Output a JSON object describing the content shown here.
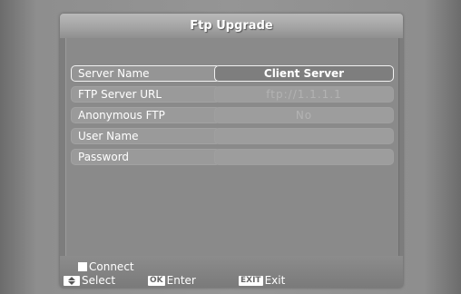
{
  "title": "Ftp Upgrade",
  "fields": [
    {
      "label": "Server Name",
      "value": "Client Server"
    },
    {
      "label": "FTP Server URL",
      "value": "ftp://1.1.1.1"
    },
    {
      "label": "Anonymous FTP",
      "value": "No"
    },
    {
      "label": "User Name",
      "value": ""
    },
    {
      "label": "Password",
      "value": ""
    }
  ],
  "selected_index": 0,
  "connect_label": "Connect",
  "help": {
    "select_label": "Select",
    "ok_key": "OK",
    "enter_label": "Enter",
    "exit_key": "EXIT",
    "exit_label": "Exit"
  },
  "colors": {
    "background": "#959595",
    "panel": "#8a8a8a",
    "highlight_border": "#f2f2f2",
    "text": "#ffffff"
  }
}
